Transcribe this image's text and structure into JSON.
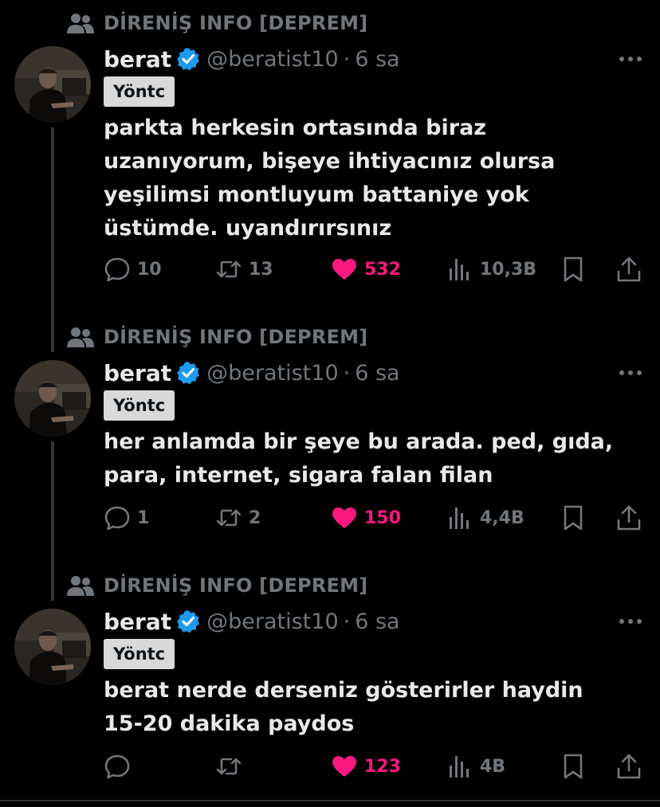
{
  "tweets": [
    {
      "community": "DİRENİŞ INFO [DEPREM]",
      "name": "berat",
      "handle": "@beratist10",
      "dot": "·",
      "time": "6 sa",
      "badge": "Yöntc",
      "text": "parkta herkesin ortasında biraz\nuzanıyorum, bişeye ihtiyacınız olursa\nyeşilimsi montluyum battaniye yok\nüstümde. uyandırırsınız",
      "replies": "10",
      "retweets": "13",
      "likes": "532",
      "views": "10,3B"
    },
    {
      "community": "DİRENİŞ INFO [DEPREM]",
      "name": "berat",
      "handle": "@beratist10",
      "dot": "·",
      "time": "6 sa",
      "badge": "Yöntc",
      "text": "her anlamda bir şeye bu arada. ped, gıda,\npara, internet, sigara falan filan",
      "replies": "1",
      "retweets": "2",
      "likes": "150",
      "views": "4,4B"
    },
    {
      "community": "DİRENİŞ INFO [DEPREM]",
      "name": "berat",
      "handle": "@beratist10",
      "dot": "·",
      "time": "6 sa",
      "badge": "Yöntc",
      "text": "berat nerde derseniz gösterirler haydin\n15-20 dakika paydos",
      "replies": "",
      "retweets": "",
      "likes": "123",
      "views": "4B"
    }
  ],
  "colors": {
    "background": "#000000",
    "text": "#e7e9ea",
    "muted": "#71767b",
    "like": "#f91880",
    "verified": "#1d9bf0",
    "badge_bg": "#d9d9d9"
  },
  "icons": [
    "community-icon",
    "verified-badge-icon",
    "more-icon",
    "reply-icon",
    "retweet-icon",
    "heart-icon",
    "views-icon",
    "bookmark-icon",
    "share-icon"
  ]
}
